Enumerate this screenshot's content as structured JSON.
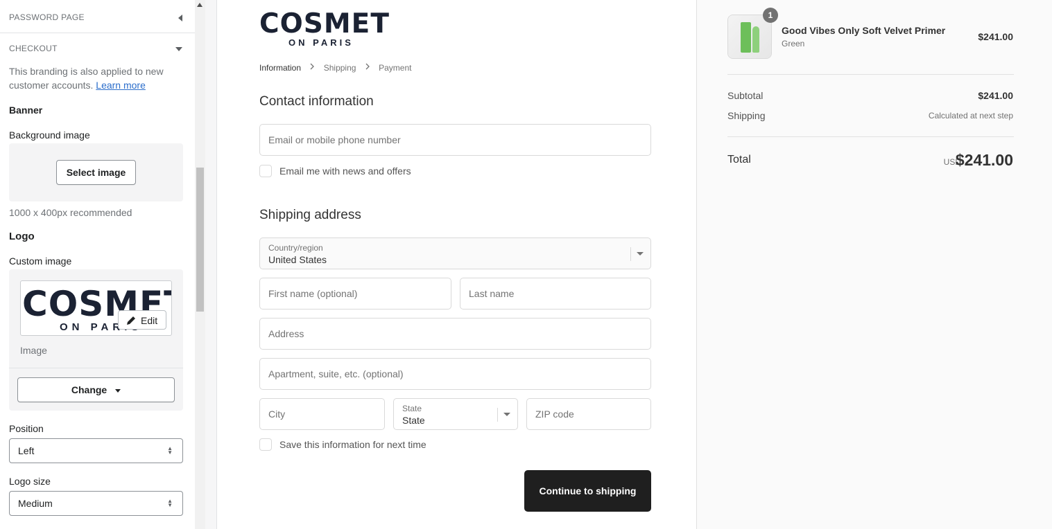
{
  "sidebar": {
    "password_page_label": "PASSWORD PAGE",
    "checkout_label": "CHECKOUT",
    "branding_note": "This branding is also applied to new customer accounts.",
    "learn_more": "Learn more",
    "banner_heading": "Banner",
    "background_image_label": "Background image",
    "select_image": "Select image",
    "bg_recommend": "1000 x 400px recommended",
    "logo_heading": "Logo",
    "custom_image_label": "Custom image",
    "logo_thumb_big": "COSMET",
    "logo_thumb_small": "ON PARIS",
    "edit_label": "Edit",
    "image_caption": "Image",
    "change_label": "Change",
    "position_label": "Position",
    "position_value": "Left",
    "logo_size_label": "Logo size",
    "logo_size_value": "Medium"
  },
  "checkout": {
    "brand_big": "COSMET",
    "brand_small": "ON PARIS",
    "breadcrumbs": [
      "Information",
      "Shipping",
      "Payment"
    ],
    "contact_heading": "Contact information",
    "email_placeholder": "Email or mobile phone number",
    "email_news_label": "Email me with news and offers",
    "shipping_heading": "Shipping address",
    "country_label": "Country/region",
    "country_value": "United States",
    "first_name_placeholder": "First name (optional)",
    "last_name_placeholder": "Last name",
    "address_placeholder": "Address",
    "apartment_placeholder": "Apartment, suite, etc. (optional)",
    "city_placeholder": "City",
    "state_label": "State",
    "state_value": "State",
    "zip_placeholder": "ZIP code",
    "save_info_label": "Save this information for next time",
    "continue_label": "Continue to shipping"
  },
  "summary": {
    "item_qty": "1",
    "item_name": "Good Vibes Only Soft Velvet Primer",
    "item_variant": "Green",
    "item_price": "$241.00",
    "subtotal_label": "Subtotal",
    "subtotal_value": "$241.00",
    "shipping_label": "Shipping",
    "shipping_value": "Calculated at next step",
    "total_label": "Total",
    "currency": "USD",
    "total_value": "$241.00"
  },
  "colors": {
    "button_dark": "#1f1f1f",
    "link_blue": "#2c6ecb",
    "brand_navy": "#1b2233",
    "product_green": "#6dbf5a"
  },
  "icons": [
    "caret-left-icon",
    "caret-down-icon",
    "pencil-icon",
    "select-arrows-icon",
    "chevron-right-icon"
  ]
}
